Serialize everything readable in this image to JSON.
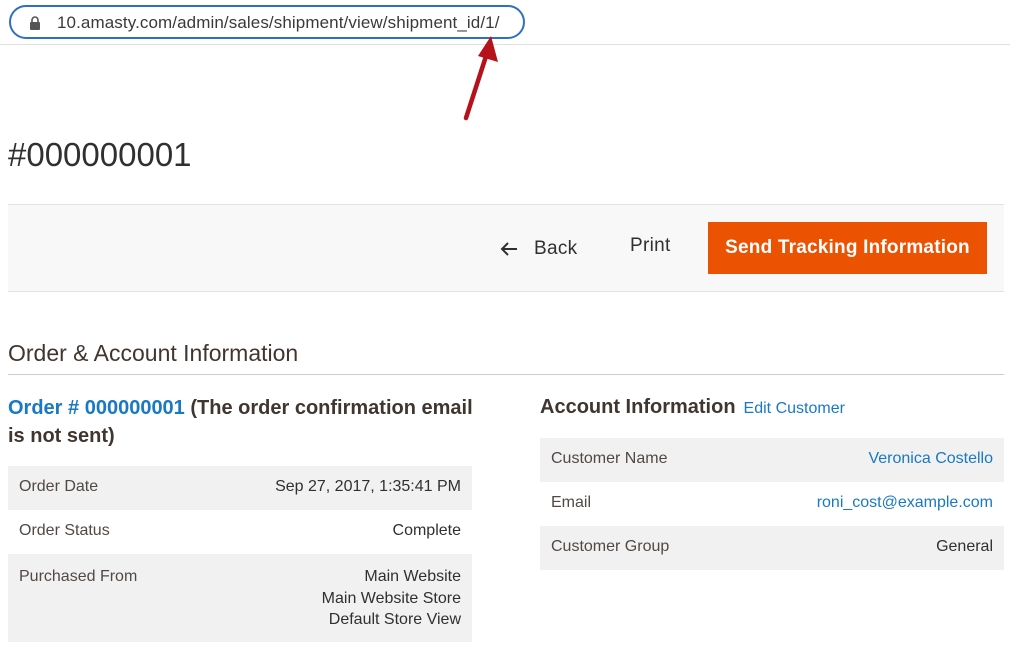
{
  "browser": {
    "url": "10.amasty.com/admin/sales/shipment/view/shipment_id/1/",
    "lock_icon": "lock-icon"
  },
  "annotation": {
    "arrow_color": "#b5121b"
  },
  "page": {
    "title": "#000000001"
  },
  "toolbar": {
    "back_label": "Back",
    "print_label": "Print",
    "send_tracking_label": "Send Tracking Information",
    "accent_color": "#eb5202"
  },
  "section": {
    "title": "Order & Account Information"
  },
  "order": {
    "link_text": "Order # 000000001",
    "note": " (The order confirmation email is not sent)",
    "rows": [
      {
        "label": "Order Date",
        "value": "Sep 27, 2017, 1:35:41 PM"
      },
      {
        "label": "Order Status",
        "value": "Complete"
      },
      {
        "label": "Purchased From",
        "value_lines": [
          "Main Website",
          "Main Website Store",
          "Default Store View"
        ]
      }
    ]
  },
  "account": {
    "heading": "Account Information",
    "edit_link": "Edit Customer",
    "rows": [
      {
        "label": "Customer Name",
        "value": "Veronica Costello"
      },
      {
        "label": "Email",
        "value": "roni_cost@example.com"
      },
      {
        "label": "Customer Group",
        "value": "General"
      }
    ]
  }
}
